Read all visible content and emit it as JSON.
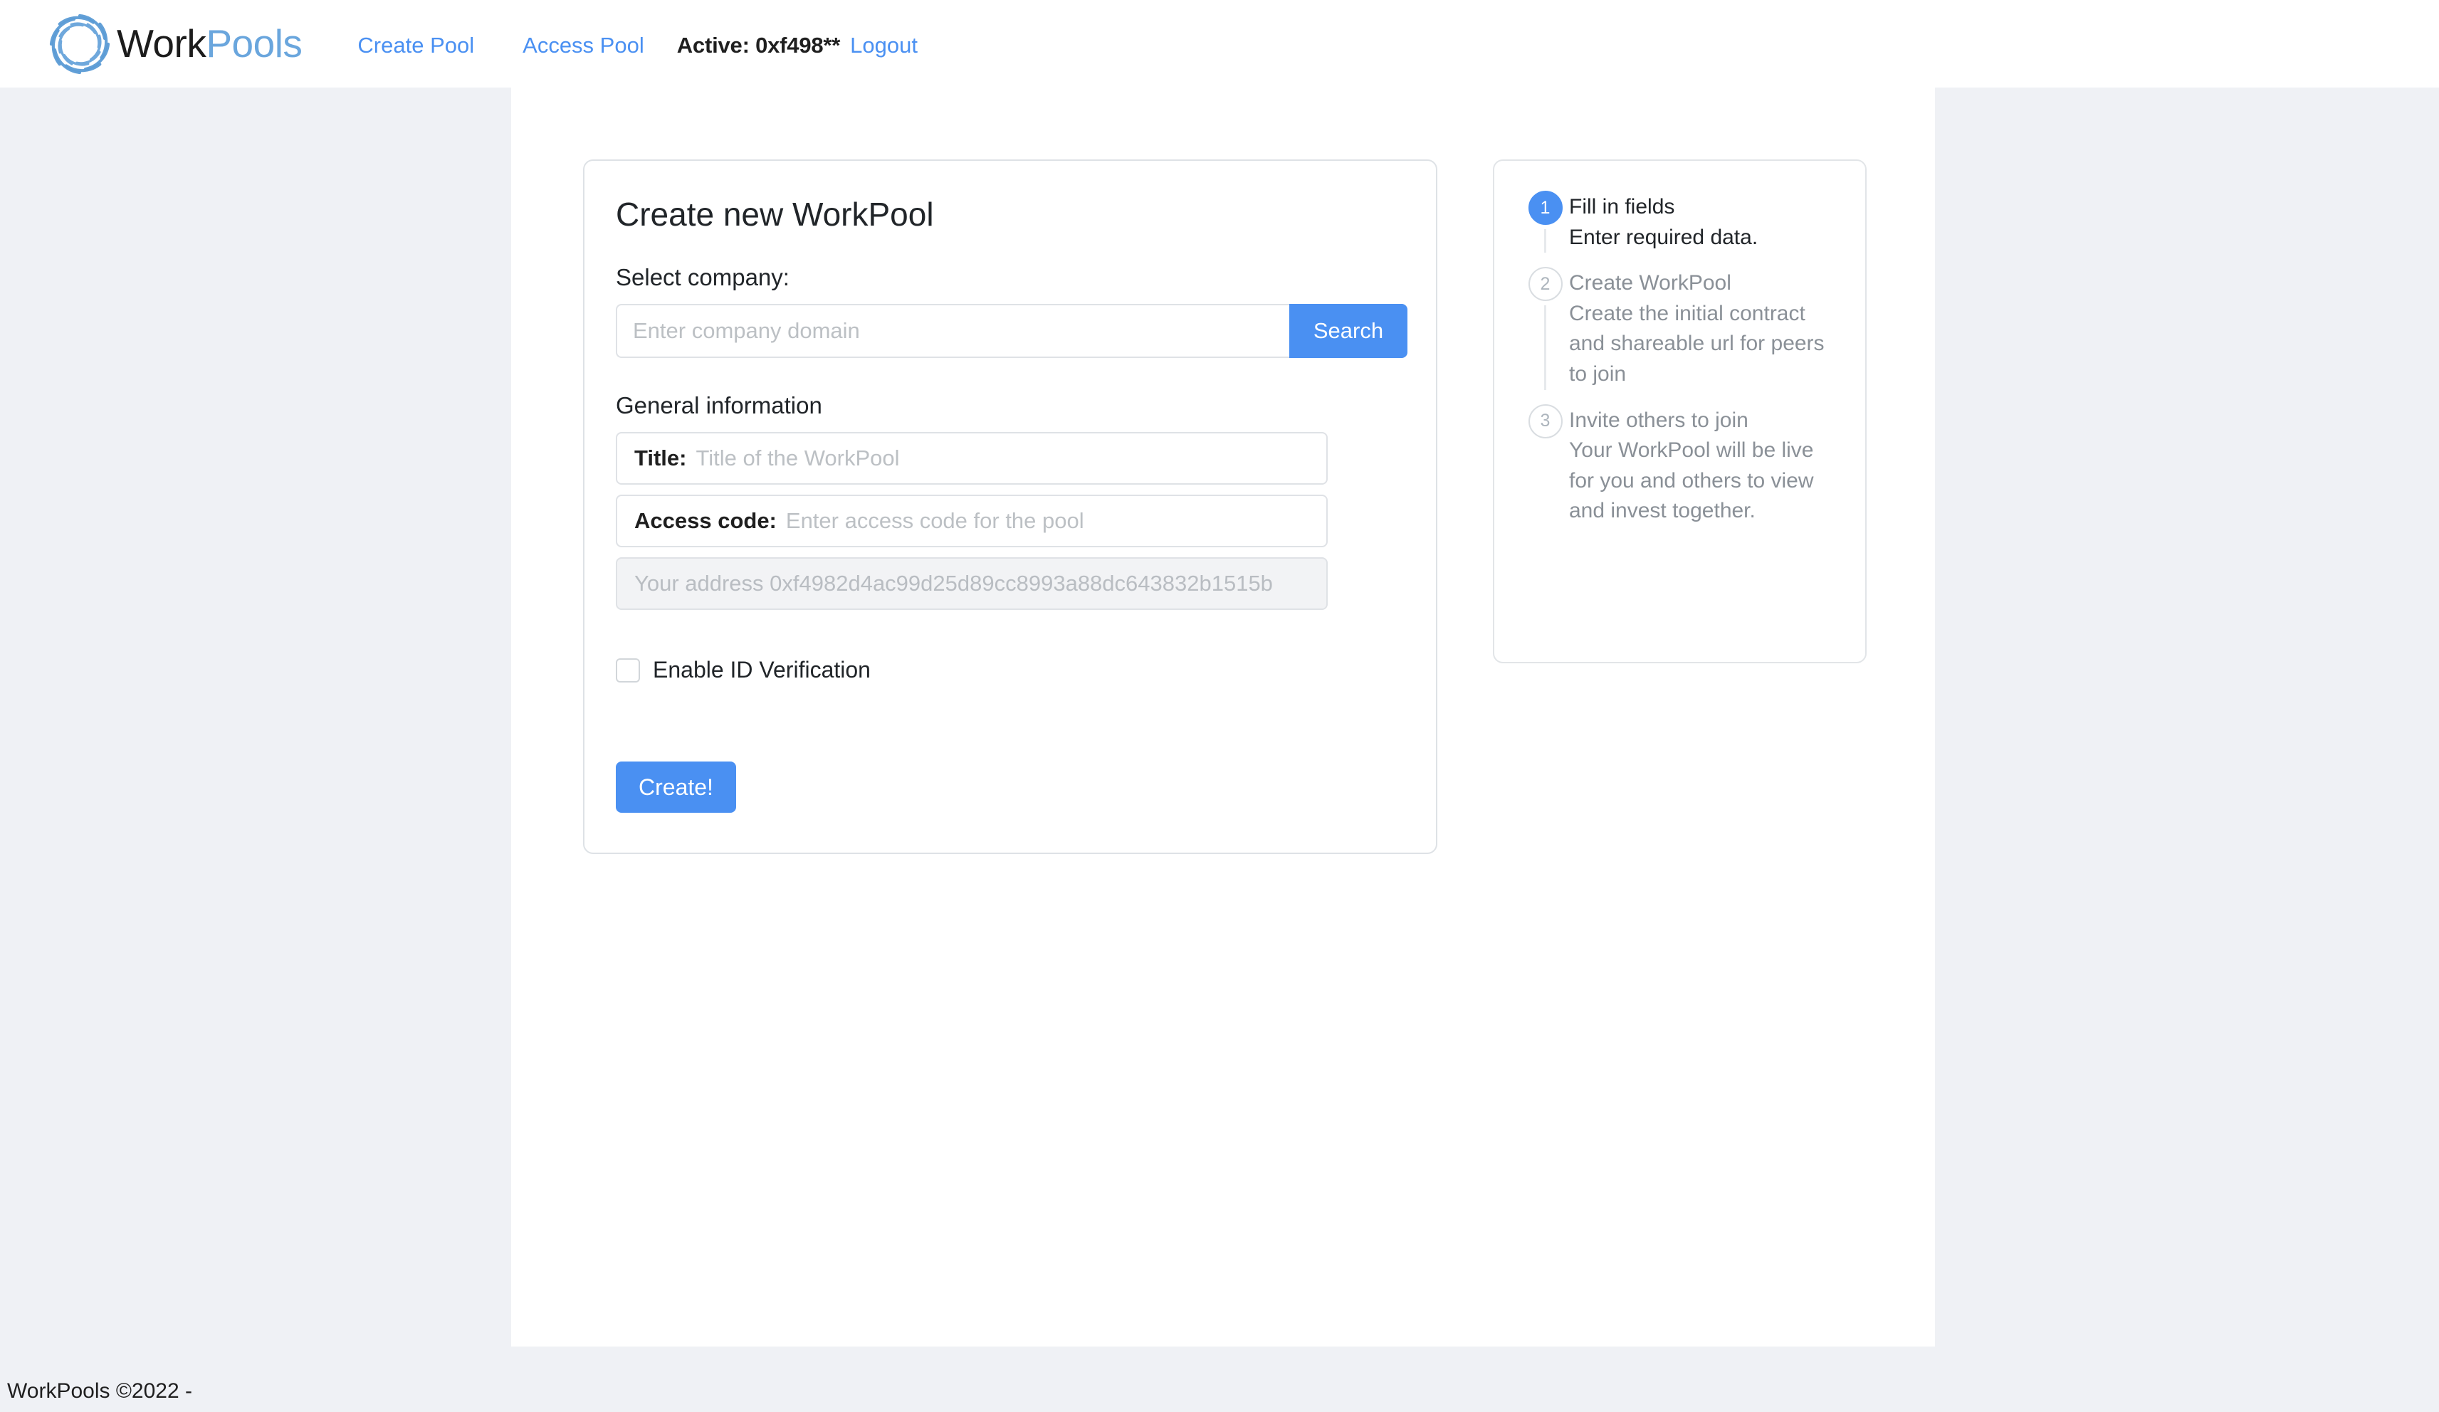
{
  "brand": {
    "logo_icon": "swirl-spiral-logo-icon",
    "name_primary": "Work",
    "name_secondary": "Pools",
    "accent_blue": "#6aa6dd"
  },
  "navbar": {
    "links": [
      {
        "label": "Create Pool",
        "name": "create-pool"
      },
      {
        "label": "Access Pool",
        "name": "access-pool"
      }
    ],
    "active_account": "Active: 0xf498**",
    "logout_label": "Logout",
    "link_color": "#4a90f2"
  },
  "main": {
    "card_title": "Create new WorkPool",
    "select_company_label": "Select company:",
    "company_search": {
      "placeholder": "Enter company domain",
      "value": "",
      "button_label": "Search"
    },
    "general_info_label": "General information",
    "fields": [
      {
        "label": "Title:",
        "placeholder": "Title of the WorkPool",
        "value": "",
        "name": "title"
      },
      {
        "label": "Access code:",
        "placeholder": "Enter access code for the pool",
        "value": "",
        "name": "access-code"
      }
    ],
    "address_readonly": "Your address 0xf4982d4ac99d25d89cc8993a88dc643832b1515b",
    "checkbox": {
      "label": "Enable ID Verification",
      "checked": false
    },
    "submit_label": "Create!",
    "accent_blue": "#4a90f2"
  },
  "steps": [
    {
      "number": "1",
      "title": "Fill in fields",
      "description": "Enter required data.",
      "state": "active"
    },
    {
      "number": "2",
      "title": "Create WorkPool",
      "description": "Create the initial contract and shareable url for peers to join",
      "state": "idle"
    },
    {
      "number": "3",
      "title": "Invite others to join",
      "description": "Your WorkPool will be live for you and others to view and invest together.",
      "state": "idle"
    }
  ],
  "footer": {
    "text": "WorkPools ©2022 -"
  }
}
